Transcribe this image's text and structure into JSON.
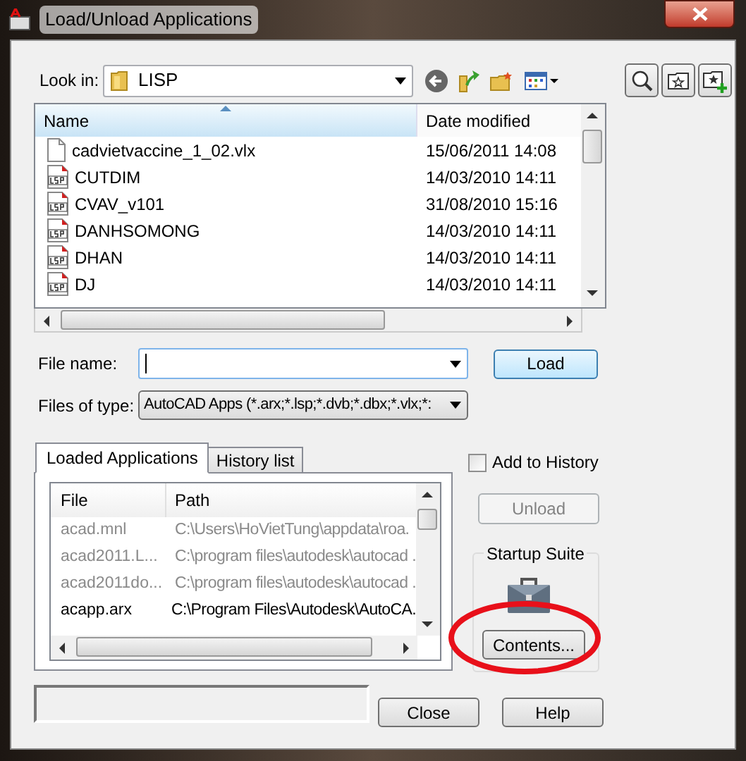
{
  "window": {
    "title": "Load/Unload Applications"
  },
  "look_in": {
    "label": "Look in:",
    "value": "LISP"
  },
  "file_list": {
    "columns": [
      "Name",
      "Date modified"
    ],
    "rows": [
      {
        "kind": "vlx",
        "name": "cadvietvaccine_1_02.vlx",
        "date": "15/06/2011 14:08"
      },
      {
        "kind": "lsp",
        "name": "CUTDIM",
        "date": "14/03/2010 14:11"
      },
      {
        "kind": "lsp",
        "name": "CVAV_v101",
        "date": "31/08/2010 15:16"
      },
      {
        "kind": "lsp",
        "name": "DANHSOMONG",
        "date": "14/03/2010 14:11"
      },
      {
        "kind": "lsp",
        "name": "DHAN",
        "date": "14/03/2010 14:11"
      },
      {
        "kind": "lsp",
        "name": "DJ",
        "date": "14/03/2010 14:11"
      }
    ]
  },
  "file_name": {
    "label": "File name:"
  },
  "load_button": "Load",
  "files_of_type": {
    "label": "Files of type:",
    "value": "AutoCAD Apps (*.arx;*.lsp;*.dvb;*.dbx;*.vlx;*:"
  },
  "tabs": [
    {
      "label": "Loaded Applications",
      "selected": true
    },
    {
      "label": "History list",
      "selected": false
    }
  ],
  "loaded_list": {
    "columns": [
      "File",
      "Path"
    ],
    "rows": [
      {
        "file": "acad.mnl",
        "path": "C:\\Users\\HoVietTung\\appdata\\roa.",
        "greyed": true
      },
      {
        "file": "acad2011.L...",
        "path": "C:\\program files\\autodesk\\autocad .",
        "greyed": true
      },
      {
        "file": "acad2011do...",
        "path": "C:\\program files\\autodesk\\autocad .",
        "greyed": true
      },
      {
        "file": "acapp.arx",
        "path": "C:\\Program Files\\Autodesk\\AutoCA.",
        "greyed": false
      }
    ]
  },
  "add_to_history": {
    "label": "Add to History",
    "checked": false
  },
  "unload_button": {
    "label": "Unload",
    "disabled": true
  },
  "startup_suite": {
    "title": "Startup Suite",
    "button": "Contents..."
  },
  "buttons": [
    "Close",
    "Help"
  ],
  "annotation": {
    "kind": "ellipse"
  }
}
